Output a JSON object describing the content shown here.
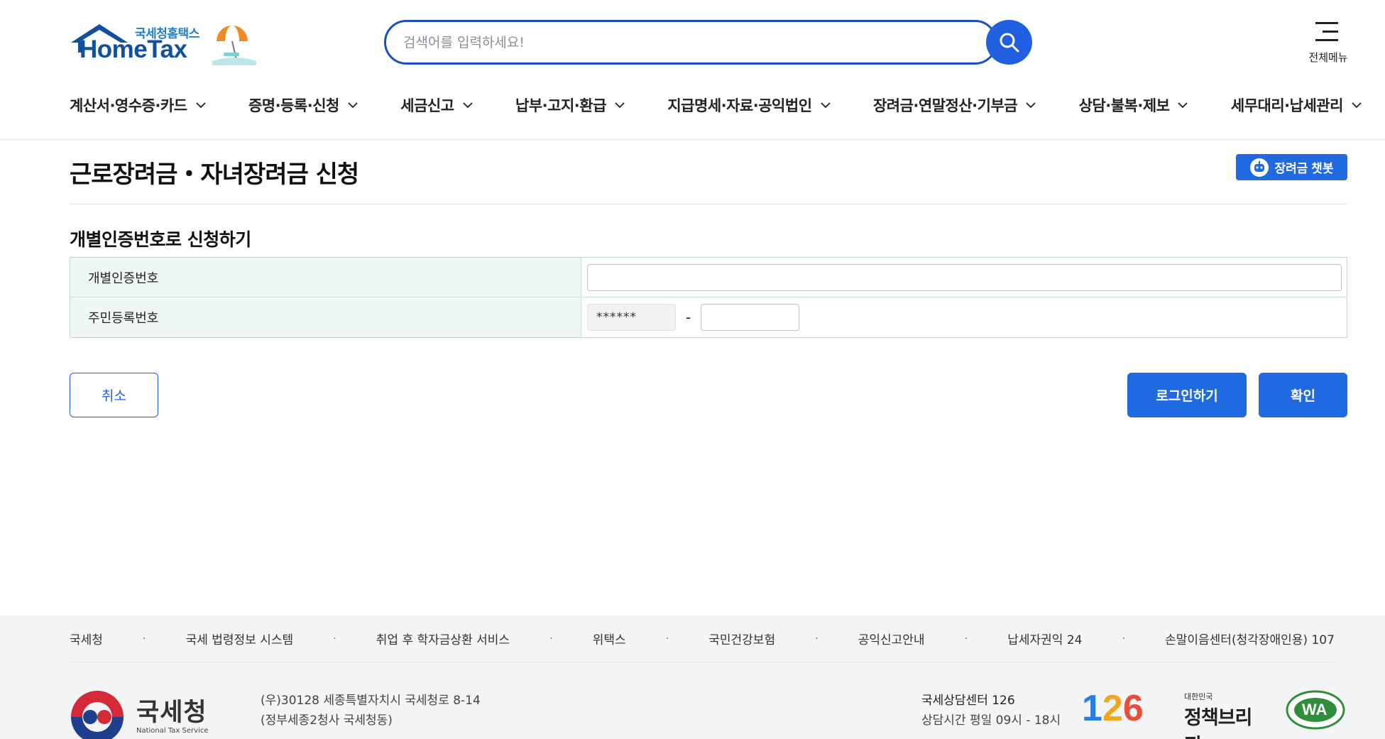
{
  "header": {
    "logo_sub": "국세청홈택스",
    "logo_main": "HomeTax",
    "search_placeholder": "검색어를 입력하세요!",
    "allmenu_label": "전체메뉴"
  },
  "gnb": [
    {
      "label": "계산서·영수증·카드"
    },
    {
      "label": "증명·등록·신청"
    },
    {
      "label": "세금신고"
    },
    {
      "label": "납부·고지·환급"
    },
    {
      "label": "지급명세·자료·공익법인"
    },
    {
      "label": "장려금·연말정산·기부금"
    },
    {
      "label": "상담·불복·제보"
    },
    {
      "label": "세무대리·납세관리"
    }
  ],
  "main": {
    "title": "근로장려금・자녀장려금 신청",
    "chatbot_label": "장려금 챗봇",
    "section_title": "개별인증번호로 신청하기",
    "rows": [
      {
        "label": "개별인증번호"
      },
      {
        "label": "주민등록번호",
        "masked_value": "******",
        "separator": "-"
      }
    ],
    "buttons": {
      "cancel": "취소",
      "login": "로그인하기",
      "confirm": "확인"
    }
  },
  "footer": {
    "links": [
      "국세청",
      "국세 법령정보 시스템",
      "취업 후 학자금상환 서비스",
      "위택스",
      "국민건강보험",
      "공익신고안내",
      "납세자권익 24",
      "손말이음센터(청각장애인용) 107"
    ],
    "link_separator": "·",
    "org_name": "국세청",
    "org_name_en": "National Tax Service",
    "address_line1": "(우)30128 세종특별자치시 국세청로 8-14",
    "address_line2": "(정부세종2청사 국세청동)",
    "callcenter_title": "국세상담센터 126",
    "callcenter_hours": "상담시간 평일 09시 - 18시",
    "badge_126": [
      "1",
      "2",
      "6"
    ],
    "briefing_small": "대한민국",
    "briefing_big": "정책브리핑",
    "wa_mark": "WA"
  },
  "colors": {
    "primary": "#1f6ae0",
    "search_border": "#1a4fc4",
    "table_header_bg": "#eef7f5",
    "footer_bg": "#f3f4f6"
  }
}
